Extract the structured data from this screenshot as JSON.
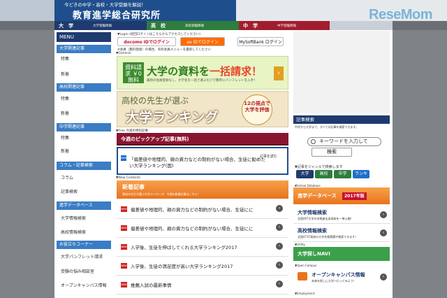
{
  "brand": {
    "watermark": "ReseMom"
  },
  "header": {
    "tagline": "今どきの中学・高校・大学受験を解説！",
    "title": "教育進学総合研究所"
  },
  "catnav": [
    {
      "label": "大　学",
      "sub": "大学受験情報"
    },
    {
      "label": "高　校",
      "sub": "高校受験情報"
    },
    {
      "label": "中　学",
      "sub": "中学受験情報"
    }
  ],
  "sidebar": {
    "menu": "MENU",
    "sections": [
      {
        "head": "大学関連記事",
        "items": [
          "特集",
          "新着"
        ]
      },
      {
        "head": "高校関連記事",
        "items": [
          "特集",
          "新着"
        ]
      },
      {
        "head": "中学関連記事",
        "items": [
          "特集",
          "新着"
        ]
      },
      {
        "head": "コラム・記事検索",
        "items": [
          "コラム",
          "記事検索"
        ]
      },
      {
        "head": "進学データベース",
        "items": [
          "大学情報検索",
          "高校情報検索"
        ]
      },
      {
        "head": "お役立ちコーナー",
        "items": [
          "大学パンフレット請求",
          "受験の悩み相談室",
          "オープンキャンパス情報"
        ]
      }
    ]
  },
  "login": {
    "label": "▼Login (初回ログインはこちらからアクセスしてください)",
    "docomo": "docomo IDでログイン",
    "au": "au IDでログイン",
    "softbank": "MySoftBank ログイン",
    "note": "※会員（無料登録）の場合、有料会員メニューを最新してください"
  },
  "general_label": "▼General",
  "banner1": {
    "badge": "資料請求 ￥0 無料",
    "title_pre": "大学の資料を",
    "title_hl": "一括請求！",
    "sub": "最新の会員登録なし、大学名を一括で選ぶだけで簡単にパンフレットを入手！"
  },
  "banner2": {
    "kicker": "高校の先生が選ぶ",
    "title": "大学ランキング",
    "badge": "12の視点で 大学を評価"
  },
  "pickup": {
    "label": "▼Free 今週の特別記事",
    "head": "今週のピックアップ記事(無料)",
    "new": "NEW",
    "badge": "記事を読む",
    "text": "「偏差値や地理的、親の資力などの制約がない場合、生徒に勧めたい大学ランキング(国)"
  },
  "news": {
    "label": "▼New Contents",
    "title": "新着記事",
    "sub": "高校の先生が選ぶ大学ランキング、今週の新着記事はこちら！",
    "items": [
      "偏差値や地理的、親の資力などの制約がない場合、生徒にに",
      "偏差値や地理的、親の資力などの制約がない場合、生徒にに",
      "入学後、生徒を伸ばしてくれる大学ランキング2017",
      "入学後、生徒の満足度が高い大学ランキング2017",
      "推薦入試の最新事情"
    ],
    "icon": "NEW",
    "arrow": "›"
  },
  "search": {
    "head": "記事検索",
    "desc": "中学から大学まで、すべての記事を検索できます。",
    "placeholder": "キーワードを入力して",
    "button": "検索",
    "genre_label": "▼記事をジャンルで検索します",
    "tabs": [
      "大学",
      "高校",
      "中学",
      "ランキ"
    ]
  },
  "school_db": {
    "label": "▼School Database",
    "head": "進学データベース",
    "badge": "2017年版",
    "items": [
      {
        "title": "大学情報検索",
        "sub": "全国497大学の合格者出身高校を一挙公開！"
      },
      {
        "title": "高校情報検索",
        "sub": "全国4737高校の大学合格実績が検索できます！"
      }
    ]
  },
  "utility_label": "▼Utility",
  "navi_head": "大学探しNAVI",
  "open_campus": {
    "label": "▼Open Campus",
    "title": "オープンキャンパス情報",
    "sub": "未来を探しに大学へ行ってみよう！"
  },
  "employment_label": "▼Employment"
}
